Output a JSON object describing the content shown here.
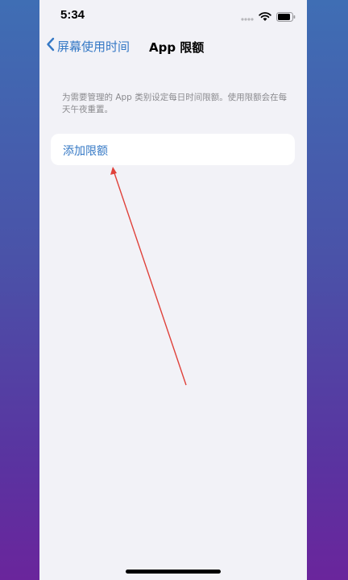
{
  "status_bar": {
    "time": "5:34",
    "icons": [
      "signal-dots-icon",
      "wifi-icon",
      "battery-icon"
    ]
  },
  "nav": {
    "back_label": "屏幕使用时间",
    "title": "App 限额"
  },
  "main": {
    "description": "为需要管理的 App 类别设定每日时间限额。使用限额会在每天午夜重置。",
    "add_limit_label": "添加限额"
  },
  "colors": {
    "accent": "#3478c5",
    "background": "#f2f2f7",
    "annotation_arrow": "#e0413a"
  }
}
